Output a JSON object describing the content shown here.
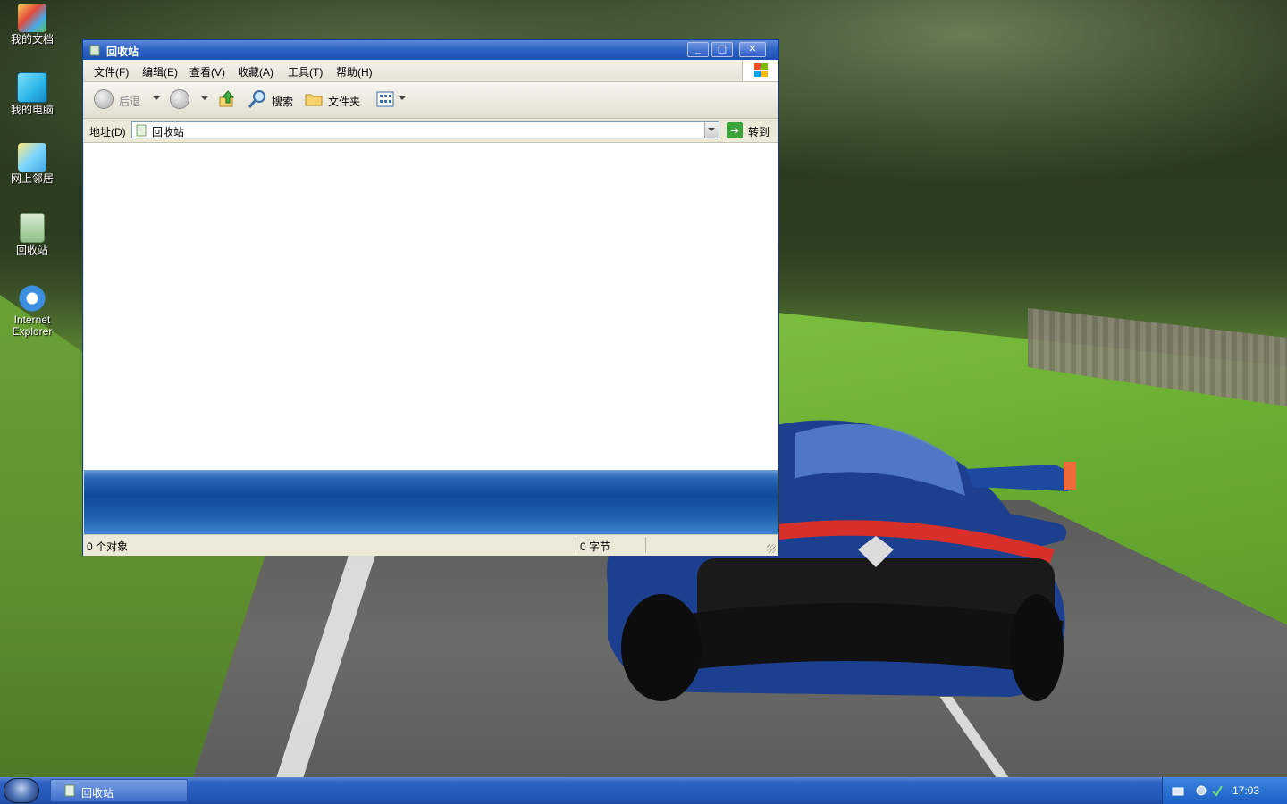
{
  "desktop": {
    "icons": [
      {
        "label": "我的文档",
        "icon": "my-documents-icon"
      },
      {
        "label": "我的电脑",
        "icon": "my-computer-icon"
      },
      {
        "label": "网上邻居",
        "icon": "network-places-icon"
      },
      {
        "label": "回收站",
        "icon": "recycle-bin-icon"
      },
      {
        "label": "Internet Explorer",
        "icon": "internet-explorer-icon"
      }
    ]
  },
  "window": {
    "title": "回收站",
    "menu": [
      "文件(F)",
      "编辑(E)",
      "查看(V)",
      "收藏(A)",
      "工具(T)",
      "帮助(H)"
    ],
    "toolbar": {
      "back_label": "后退",
      "search_label": "搜索",
      "folders_label": "文件夹"
    },
    "address": {
      "label": "地址(D)",
      "value": "回收站",
      "go_label": "转到"
    },
    "status": {
      "objects": "0 个对象",
      "size": "0 字节"
    }
  },
  "taskbar": {
    "task_label": "回收站",
    "clock": "17:03"
  },
  "colors": {
    "titlebar": "#2f63c6",
    "taskbar": "#2456b8",
    "window_bg": "#ece9d8"
  }
}
